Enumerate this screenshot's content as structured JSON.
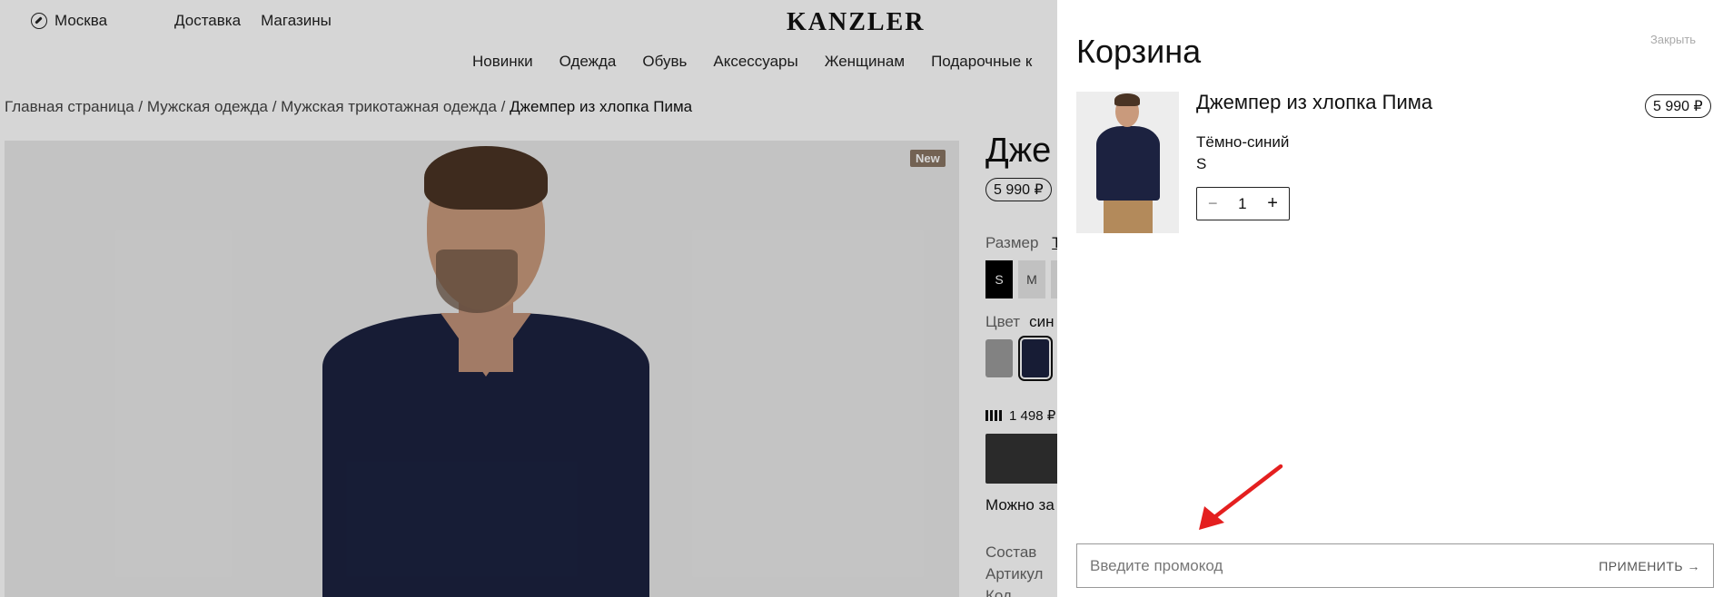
{
  "header": {
    "city": "Москва",
    "links": [
      "Доставка",
      "Магазины"
    ],
    "logo": "KANZLER",
    "nav": [
      "Новинки",
      "Одежда",
      "Обувь",
      "Аксессуары",
      "Женщинам",
      "Подарочные к"
    ]
  },
  "breadcrumbs": {
    "items": [
      "Главная страница",
      "Мужская одежда",
      "Мужская трикотажная одежда"
    ],
    "separator": " / ",
    "current": "Джемпер из хлопка Пима"
  },
  "product": {
    "badge": "New",
    "title_visible": "Дже",
    "price": "5 990 ₽",
    "size_label": "Размер",
    "size_link": "Т",
    "sizes": [
      "S",
      "M",
      ""
    ],
    "selected_size": "S",
    "color_label": "Цвет",
    "color_value": "син",
    "swatches": [
      "#9b9b9b",
      "#1c2240",
      "#d8b6a0"
    ],
    "installment": "1 498 ₽",
    "can_text": "Можно за",
    "specs": [
      "Состав",
      "Артикул",
      "Код"
    ]
  },
  "cart": {
    "title": "Корзина",
    "close_label": "Закрыть",
    "item": {
      "name": "Джемпер из хлопка Пима",
      "price": "5 990 ₽",
      "color": "Тёмно-синий",
      "size": "S",
      "qty": "1",
      "minus": "−",
      "plus": "+"
    },
    "promo": {
      "placeholder": "Введите промокод",
      "apply_label": "ПРИМЕНИТЬ →"
    }
  },
  "annotation": {
    "color": "#e41f1f",
    "icon": "red-arrow-icon"
  }
}
